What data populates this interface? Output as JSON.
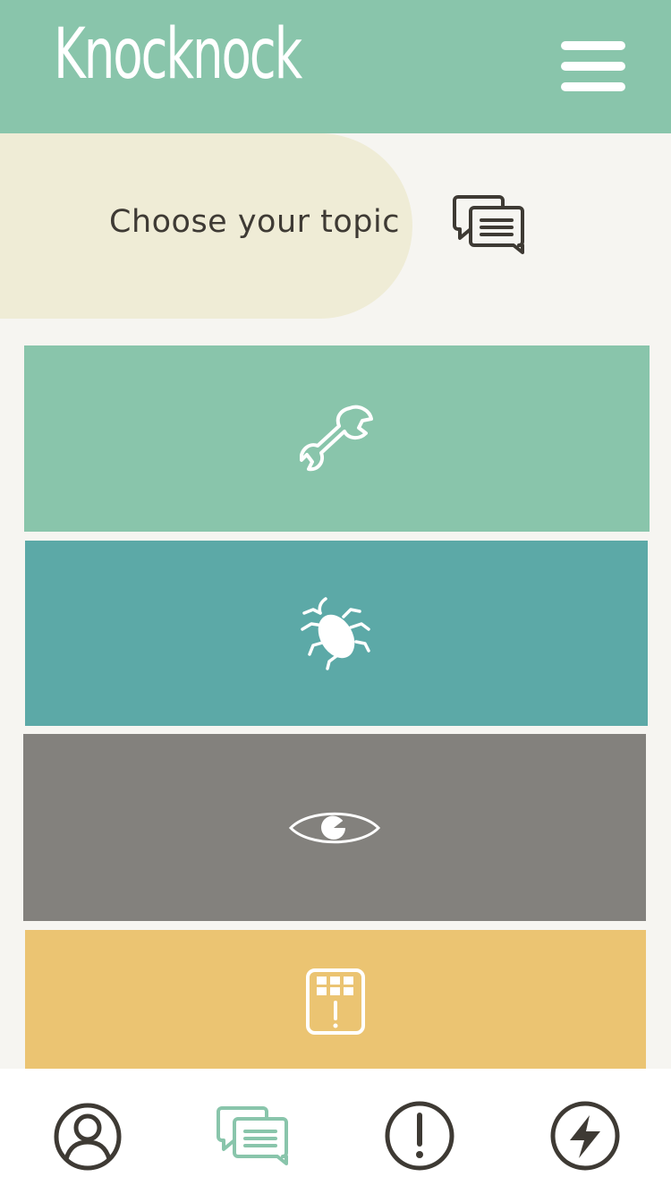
{
  "header": {
    "logo_text": "Knocknock",
    "menu_icon": "hamburger-menu-icon"
  },
  "topic_selector": {
    "label": "Choose your topic",
    "icon": "chat-bubbles-icon"
  },
  "tiles": [
    {
      "icon": "wrench-icon",
      "color": "#89c5ab"
    },
    {
      "icon": "bug-icon",
      "color": "#5ca9a7"
    },
    {
      "icon": "eye-icon",
      "color": "#83817d"
    },
    {
      "icon": "building-alert-icon",
      "color": "#ebc472"
    }
  ],
  "bottom_nav": {
    "items": [
      {
        "icon": "profile-icon",
        "active": false
      },
      {
        "icon": "chat-bubbles-icon",
        "active": true
      },
      {
        "icon": "alert-icon",
        "active": false
      },
      {
        "icon": "lightning-icon",
        "active": false
      }
    ],
    "active_color": "#89c5ab",
    "inactive_color": "#3e3a34"
  },
  "colors": {
    "header_bg": "#89c5ab",
    "page_bg": "#f6f5f1",
    "pill_bg": "#efecd6",
    "text_dark": "#3e3a34"
  }
}
